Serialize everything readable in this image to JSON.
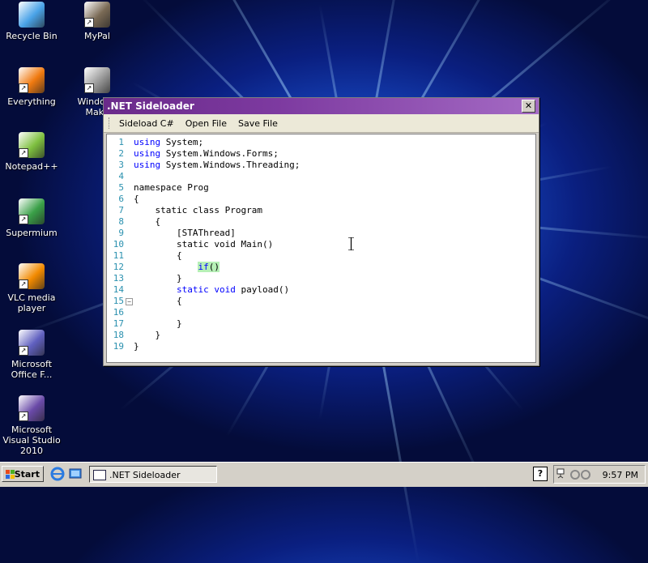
{
  "desktop": {
    "icons": [
      {
        "label": "Recycle Bin",
        "icon": "recycle-bin-icon",
        "color": "#4aa3e8"
      },
      {
        "label": "MyPal",
        "icon": "raccoon-icon",
        "color": "#7a6a55"
      },
      {
        "label": "Everything",
        "icon": "magnifier-icon",
        "color": "#f07a10"
      },
      {
        "label": "Windows Make",
        "icon": "film-reel-icon",
        "color": "#999999"
      },
      {
        "label": "Notepad++",
        "icon": "notepad-icon",
        "color": "#7fc040"
      },
      {
        "label": "Supermium",
        "icon": "browser-icon",
        "color": "#3aa048"
      },
      {
        "label": "VLC media player",
        "icon": "traffic-cone-icon",
        "color": "#f28a00"
      },
      {
        "label": "Microsoft Office F...",
        "icon": "office-icon",
        "color": "#6060c0"
      },
      {
        "label": "Microsoft Visual Studio 2010",
        "icon": "infinity-icon",
        "color": "#6a4aa8"
      }
    ]
  },
  "window": {
    "title": ".NET Sideloader",
    "close": "✕",
    "menu": [
      "Sideload C#",
      "Open File",
      "Save File"
    ],
    "code": [
      {
        "n": "1",
        "pre": "",
        "kw": "using",
        "rest": " System;"
      },
      {
        "n": "2",
        "pre": "",
        "kw": "using",
        "rest": " System.Windows.Forms;"
      },
      {
        "n": "3",
        "pre": "",
        "kw": "using",
        "rest": " System.Windows.Threading;"
      },
      {
        "n": "4",
        "pre": "",
        "kw": "",
        "rest": ""
      },
      {
        "n": "5",
        "pre": "",
        "kw": "",
        "rest": "namespace Prog"
      },
      {
        "n": "6",
        "pre": "",
        "kw": "",
        "rest": "{"
      },
      {
        "n": "7",
        "pre": "    ",
        "kw": "",
        "rest": "static class Program"
      },
      {
        "n": "8",
        "pre": "    ",
        "kw": "",
        "rest": "{"
      },
      {
        "n": "9",
        "pre": "        ",
        "kw": "",
        "rest": "[STAThread]"
      },
      {
        "n": "10",
        "pre": "        ",
        "kw": "",
        "rest": "static void Main()"
      },
      {
        "n": "11",
        "pre": "        ",
        "kw": "",
        "rest": "{"
      },
      {
        "n": "12",
        "pre": "            ",
        "kw": "if",
        "rest": "()"
      },
      {
        "n": "13",
        "pre": "        ",
        "kw": "",
        "rest": "}"
      },
      {
        "n": "14",
        "pre": "        ",
        "kw": "static void",
        "rest": " payload()"
      },
      {
        "n": "15",
        "pre": "        ",
        "kw": "",
        "rest": "{"
      },
      {
        "n": "16",
        "pre": "",
        "kw": "",
        "rest": ""
      },
      {
        "n": "17",
        "pre": "        ",
        "kw": "",
        "rest": "}"
      },
      {
        "n": "18",
        "pre": "    ",
        "kw": "",
        "rest": "}"
      },
      {
        "n": "19",
        "pre": "",
        "kw": "",
        "rest": "}"
      }
    ],
    "fold_marker": "−",
    "accent": "#7d3aa0"
  },
  "taskbar": {
    "start_label": "Start",
    "task_label": ".NET Sideloader",
    "help": "?",
    "time": "9:57 PM"
  }
}
